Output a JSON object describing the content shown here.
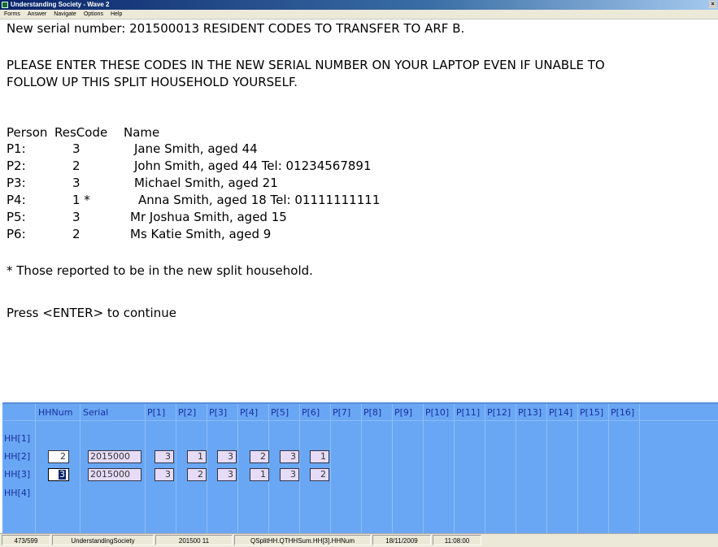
{
  "window": {
    "title": "Understanding Society - Wave 2"
  },
  "menu": [
    "Forms",
    "Answer",
    "Navigate",
    "Options",
    "Help"
  ],
  "question": {
    "line1": "New serial number: 201500013    RESIDENT CODES TO TRANSFER TO ARF B.",
    "line2": "PLEASE ENTER THESE CODES IN THE NEW SERIAL NUMBER ON YOUR LAPTOP EVEN IF UNABLE TO",
    "line3": "FOLLOW UP THIS SPLIT HOUSEHOLD YOURSELF.",
    "table_header": {
      "person": "Person",
      "rescode": "ResCode",
      "name": "Name"
    },
    "persons": [
      {
        "id": "P1:",
        "code": "3",
        "name": "Jane Smith, aged 44"
      },
      {
        "id": "P2:",
        "code": "2",
        "name": "John Smith, aged 44  Tel:  01234567891"
      },
      {
        "id": "P3:",
        "code": "3",
        "name": "Michael Smith, aged 21"
      },
      {
        "id": "P4:",
        "code": "1 *",
        "name": "Anna Smith, aged 18  Tel:  01111111111"
      },
      {
        "id": "P5:",
        "code": "3",
        "name": "Mr Joshua Smith, aged 15"
      },
      {
        "id": "P6:",
        "code": "2",
        "name": "Ms Katie Smith, aged 9"
      }
    ],
    "footnote": "* Those reported to be in the new split household.",
    "prompt": "Press <ENTER> to continue"
  },
  "grid": {
    "columns": [
      "HHNum",
      "Serial",
      "P[1]",
      "P[2]",
      "P[3]",
      "P[4]",
      "P[5]",
      "P[6]",
      "P[7]",
      "P[8]",
      "P[9]",
      "P[10]",
      "P[11]",
      "P[12]",
      "P[13]",
      "P[14]",
      "P[15]",
      "P[16]"
    ],
    "rows": [
      "HH[1]",
      "HH[2]",
      "HH[3]",
      "HH[4]"
    ],
    "hh2": {
      "hhnum": "2",
      "serial": "2015000",
      "p": [
        "3",
        "1",
        "3",
        "2",
        "3",
        "1"
      ]
    },
    "hh3": {
      "hhnum": "3",
      "serial": "2015000",
      "p": [
        "3",
        "2",
        "3",
        "1",
        "3",
        "2"
      ]
    }
  },
  "status": {
    "position": "473/599",
    "survey": "UnderstandingSociety",
    "serial": "201500 11",
    "field": "QSplitHH.QTHHSum.HH[3].HHNum",
    "date": "18/11/2009",
    "time": "11:08:00"
  }
}
